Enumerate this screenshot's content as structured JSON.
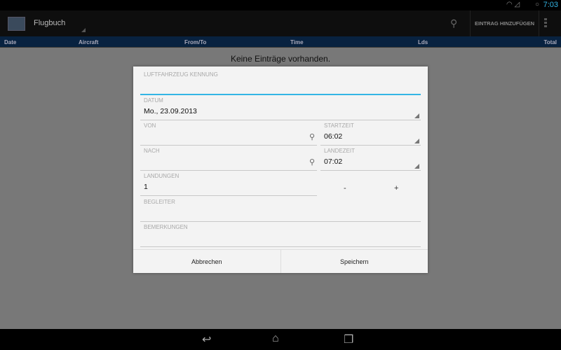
{
  "status": {
    "time": "7:03"
  },
  "actionbar": {
    "title": "Flugbuch",
    "add_entry": "EINTRAG HINZUFÜGEN"
  },
  "columns": [
    "Date",
    "Aircraft",
    "From/To",
    "Time",
    "Lds",
    "Total"
  ],
  "empty_text": "Keine Einträge vorhanden.",
  "dialog": {
    "aircraft": {
      "label": "LUFTFAHRZEUG KENNUNG",
      "value": ""
    },
    "date": {
      "label": "DATUM",
      "value": "Mo., 23.09.2013"
    },
    "from": {
      "label": "VON",
      "value": ""
    },
    "start": {
      "label": "STARTZEIT",
      "value": "06:02"
    },
    "to": {
      "label": "NACH",
      "value": ""
    },
    "land": {
      "label": "LANDEZEIT",
      "value": "07:02"
    },
    "landings": {
      "label": "LANDUNGEN",
      "value": "1",
      "minus": "-",
      "plus": "+"
    },
    "companion": {
      "label": "BEGLEITER",
      "value": ""
    },
    "remarks": {
      "label": "BEMERKUNGEN",
      "value": ""
    },
    "cancel": "Abbrechen",
    "save": "Speichern"
  }
}
